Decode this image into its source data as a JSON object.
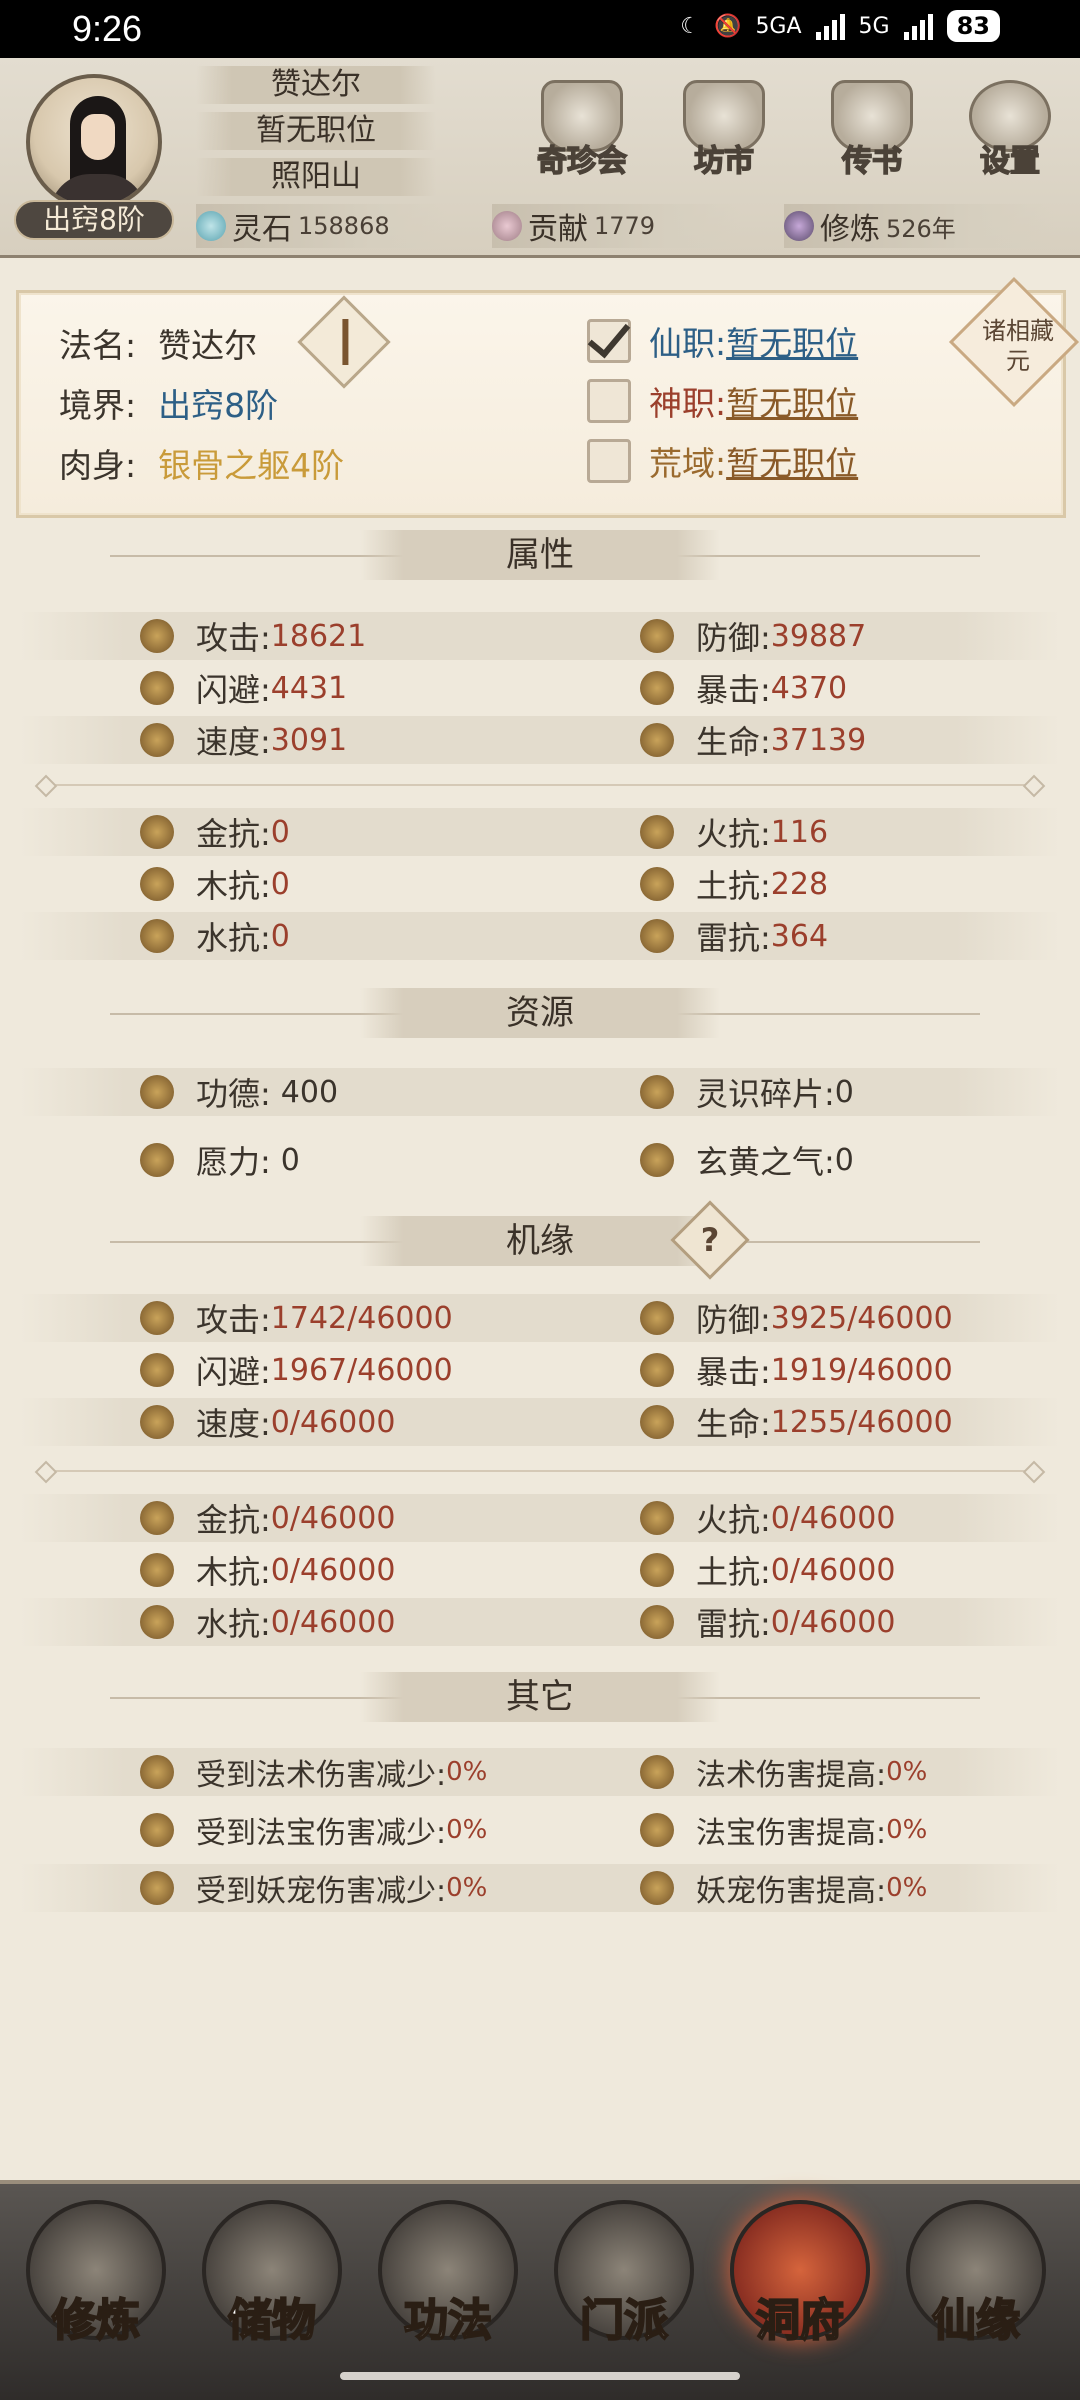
{
  "status_bar": {
    "time": "9:26",
    "network1": "5GA",
    "network2": "5G",
    "battery": "83"
  },
  "header": {
    "realm_badge": "出窍8阶",
    "name": "赞达尔",
    "position": "暂无职位",
    "location": "照阳山",
    "resources": [
      {
        "label": "灵石",
        "value": "158868"
      },
      {
        "label": "贡献",
        "value": "1779"
      },
      {
        "label": "修炼",
        "value": "526年"
      }
    ],
    "buttons": [
      {
        "label": "奇珍会",
        "icon": "treasure-pavilion-icon"
      },
      {
        "label": "坊市",
        "icon": "market-icon"
      },
      {
        "label": "传书",
        "icon": "letter-icon"
      },
      {
        "label": "设置",
        "icon": "gear-icon"
      }
    ]
  },
  "info": {
    "dharma_name_label": "法名:",
    "dharma_name": "赞达尔",
    "realm_label": "境界:",
    "realm": "出窍8阶",
    "body_label": "肉身:",
    "body": "银骨之躯4阶",
    "posts": [
      {
        "label": "仙职:",
        "value": "暂无职位",
        "checked": true
      },
      {
        "label": "神职:",
        "value": "暂无职位",
        "checked": false
      },
      {
        "label": "荒域:",
        "value": "暂无职位",
        "checked": false
      }
    ],
    "corner_button": "诸相藏元"
  },
  "sections": {
    "attributes": "属性",
    "resources": "资源",
    "opportunity": "机缘",
    "other": "其它"
  },
  "attributes": {
    "main": [
      {
        "k": "攻击:",
        "v": "18621"
      },
      {
        "k": "防御:",
        "v": "39887"
      },
      {
        "k": "闪避:",
        "v": "4431"
      },
      {
        "k": "暴击:",
        "v": "4370"
      },
      {
        "k": "速度:",
        "v": "3091"
      },
      {
        "k": "生命:",
        "v": "37139"
      }
    ],
    "resist": [
      {
        "k": "金抗:",
        "v": "0"
      },
      {
        "k": "火抗:",
        "v": "116"
      },
      {
        "k": "木抗:",
        "v": "0"
      },
      {
        "k": "土抗:",
        "v": "228"
      },
      {
        "k": "水抗:",
        "v": "0"
      },
      {
        "k": "雷抗:",
        "v": "364"
      }
    ]
  },
  "resources": [
    {
      "k": "功德:",
      "v": "400"
    },
    {
      "k": "灵识碎片:",
      "v": "0"
    },
    {
      "k": "愿力:",
      "v": "0"
    },
    {
      "k": "玄黄之气:",
      "v": "0"
    }
  ],
  "opportunity": {
    "main": [
      {
        "k": "攻击:",
        "v": "1742/46000"
      },
      {
        "k": "防御:",
        "v": "3925/46000"
      },
      {
        "k": "闪避:",
        "v": "1967/46000"
      },
      {
        "k": "暴击:",
        "v": "1919/46000"
      },
      {
        "k": "速度:",
        "v": "0/46000"
      },
      {
        "k": "生命:",
        "v": "1255/46000"
      }
    ],
    "resist": [
      {
        "k": "金抗:",
        "v": "0/46000"
      },
      {
        "k": "火抗:",
        "v": "0/46000"
      },
      {
        "k": "木抗:",
        "v": "0/46000"
      },
      {
        "k": "土抗:",
        "v": "0/46000"
      },
      {
        "k": "水抗:",
        "v": "0/46000"
      },
      {
        "k": "雷抗:",
        "v": "0/46000"
      }
    ],
    "help": "?"
  },
  "other": [
    {
      "k": "受到法术伤害减少:",
      "v": "0%"
    },
    {
      "k": "法术伤害提高:",
      "v": "0%"
    },
    {
      "k": "受到法宝伤害减少:",
      "v": "0%"
    },
    {
      "k": "法宝伤害提高:",
      "v": "0%"
    },
    {
      "k": "受到妖宠伤害减少:",
      "v": "0%"
    },
    {
      "k": "妖宠伤害提高:",
      "v": "0%"
    }
  ],
  "bottom_nav": [
    {
      "label": "修炼"
    },
    {
      "label": "储物"
    },
    {
      "label": "功法"
    },
    {
      "label": "门派"
    },
    {
      "label": "洞府",
      "active": true
    },
    {
      "label": "仙缘"
    }
  ]
}
